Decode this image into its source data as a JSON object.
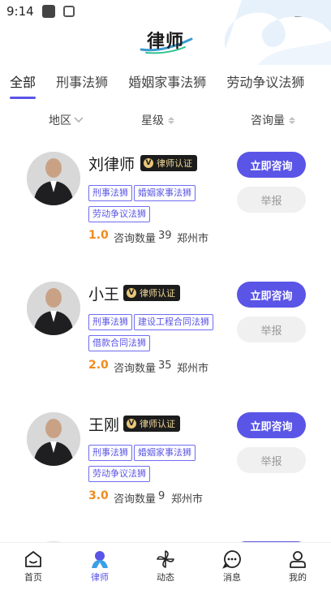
{
  "status_bar": {
    "time": "9:14"
  },
  "header": {
    "logo_text": "律师"
  },
  "tabs": [
    {
      "label": "全部",
      "active": true
    },
    {
      "label": "刑事法狮",
      "active": false
    },
    {
      "label": "婚姻家事法狮",
      "active": false
    },
    {
      "label": "劳动争议法狮",
      "active": false
    }
  ],
  "filters": {
    "region": "地区",
    "rating": "星级",
    "consult_count": "咨询量"
  },
  "lawyers": [
    {
      "name": "刘律师",
      "badge": "律师认证",
      "tags": [
        "刑事法狮",
        "婚姻家事法狮",
        "劳动争议法狮"
      ],
      "rating": "1.0",
      "consult_label": "咨询数量",
      "consult_count": "39",
      "city": "郑州市",
      "consult_button": "立即咨询",
      "report_button": "举报"
    },
    {
      "name": "小王",
      "badge": "律师认证",
      "tags": [
        "刑事法狮",
        "建设工程合同法狮",
        "借款合同法狮"
      ],
      "rating": "2.0",
      "consult_label": "咨询数量",
      "consult_count": "35",
      "city": "郑州市",
      "consult_button": "立即咨询",
      "report_button": "举报"
    },
    {
      "name": "王刚",
      "badge": "律师认证",
      "tags": [
        "刑事法狮",
        "婚姻家事法狮",
        "劳动争议法狮"
      ],
      "rating": "3.0",
      "consult_label": "咨询数量",
      "consult_count": "9",
      "city": "郑州市",
      "consult_button": "立即咨询",
      "report_button": "举报"
    }
  ],
  "bottom_nav": [
    {
      "label": "首页",
      "icon": "home-icon",
      "active": false
    },
    {
      "label": "律师",
      "icon": "lawyer-icon",
      "active": true
    },
    {
      "label": "动态",
      "icon": "pinwheel-icon",
      "active": false
    },
    {
      "label": "消息",
      "icon": "message-icon",
      "active": false
    },
    {
      "label": "我的",
      "icon": "profile-icon",
      "active": false
    }
  ],
  "colors": {
    "accent": "#5a55e6",
    "rating": "#f08b1e",
    "badge_bg": "#1c1c1c",
    "badge_text": "#f1d89a"
  }
}
